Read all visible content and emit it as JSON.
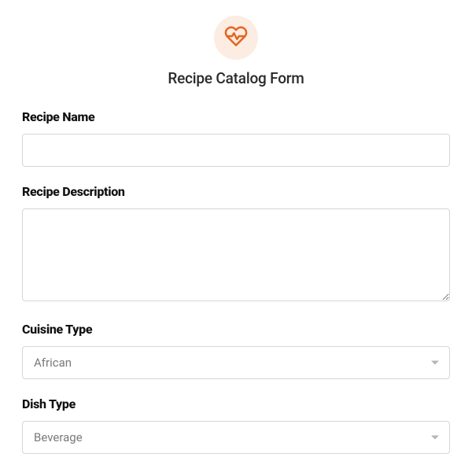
{
  "header": {
    "title": "Recipe Catalog Form",
    "icon": "heart-pulse-icon"
  },
  "fields": {
    "recipe_name": {
      "label": "Recipe Name",
      "value": ""
    },
    "recipe_description": {
      "label": "Recipe Description",
      "value": ""
    },
    "cuisine_type": {
      "label": "Cuisine Type",
      "selected": "African"
    },
    "dish_type": {
      "label": "Dish Type",
      "selected": "Beverage"
    }
  }
}
